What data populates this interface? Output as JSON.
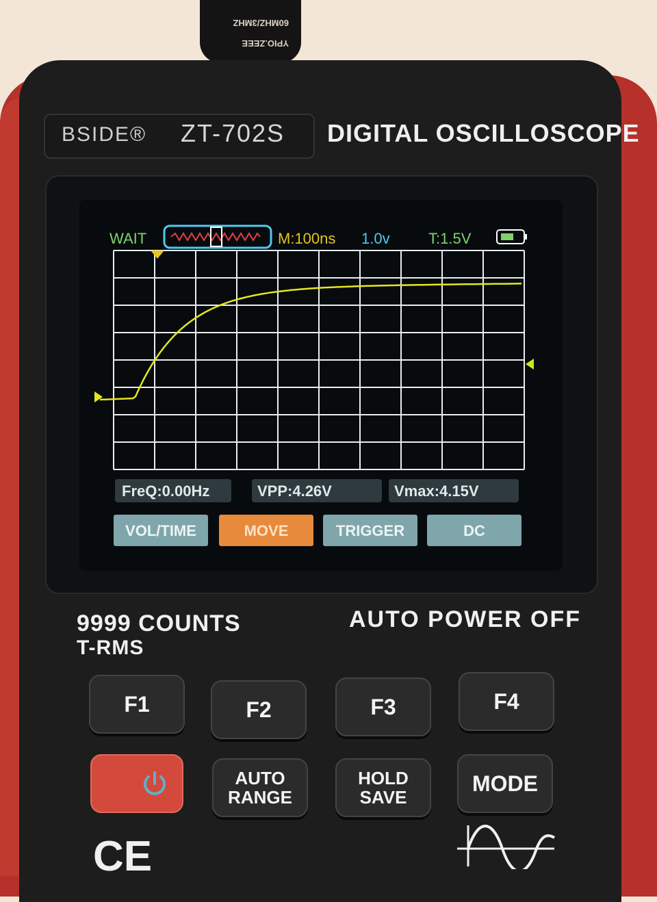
{
  "cable": {
    "text": "YPIO.ZEEE 60MHZ/3MHZ"
  },
  "device": {
    "brand": "BSIDE®",
    "model": "ZT-702S",
    "title": "DIGITAL OSCILLOSCOPE",
    "features": {
      "counts": "9999 COUNTS",
      "trms": "T-RMS",
      "auto_off": "AUTO POWER OFF"
    },
    "certification": "CE"
  },
  "screen": {
    "status": "WAIT",
    "timebase": "M:100ns",
    "volts_div": "1.0v",
    "trigger_level": "T:1.5V",
    "measurements": {
      "freq": "FreQ:0.00Hz",
      "vpp": "VPP:4.26V",
      "vmax": "Vmax:4.15V"
    },
    "softkeys": [
      "VOL/TIME",
      "MOVE",
      "TRIGGER",
      "DC"
    ],
    "selected_softkey": "MOVE"
  },
  "keys": {
    "f1": "F1",
    "f2": "F2",
    "f3": "F3",
    "f4": "F4",
    "auto_range": [
      "AUTO",
      "RANGE"
    ],
    "hold_save": [
      "HOLD",
      "SAVE"
    ],
    "mode": "MODE"
  },
  "colors": {
    "trace": "#e6e61e",
    "grid": "#e8eef2",
    "status_green": "#7ed26a",
    "cyan": "#52c8ee",
    "orange": "#e88a3c",
    "softkey_bg": "#7fa6aa"
  }
}
